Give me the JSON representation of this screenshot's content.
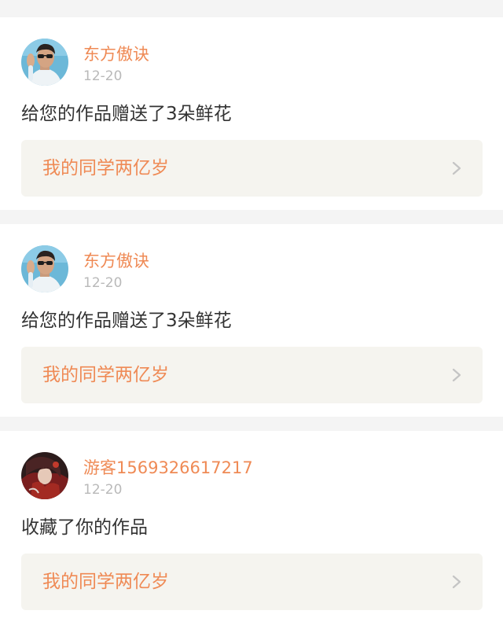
{
  "notifications": [
    {
      "user": "东方傲诀",
      "time": "12-20",
      "message": "给您的作品赠送了3朵鲜花",
      "work_title": "我的同学两亿岁",
      "avatar_icon": "person-with-sunglasses-photo"
    },
    {
      "user": "东方傲诀",
      "time": "12-20",
      "message": "给您的作品赠送了3朵鲜花",
      "work_title": "我的同学两亿岁",
      "avatar_icon": "person-with-sunglasses-photo"
    },
    {
      "user": "游客1569326617217",
      "time": "12-20",
      "message": "收藏了你的作品",
      "work_title": "我的同学两亿岁",
      "avatar_icon": "dark-red-anime-avatar"
    }
  ],
  "colors": {
    "accent": "#ef8a55",
    "timestamp": "#b9b9b9",
    "message_text": "#333333",
    "link_background": "#f5f4ef",
    "page_background": "#f4f4f4"
  }
}
